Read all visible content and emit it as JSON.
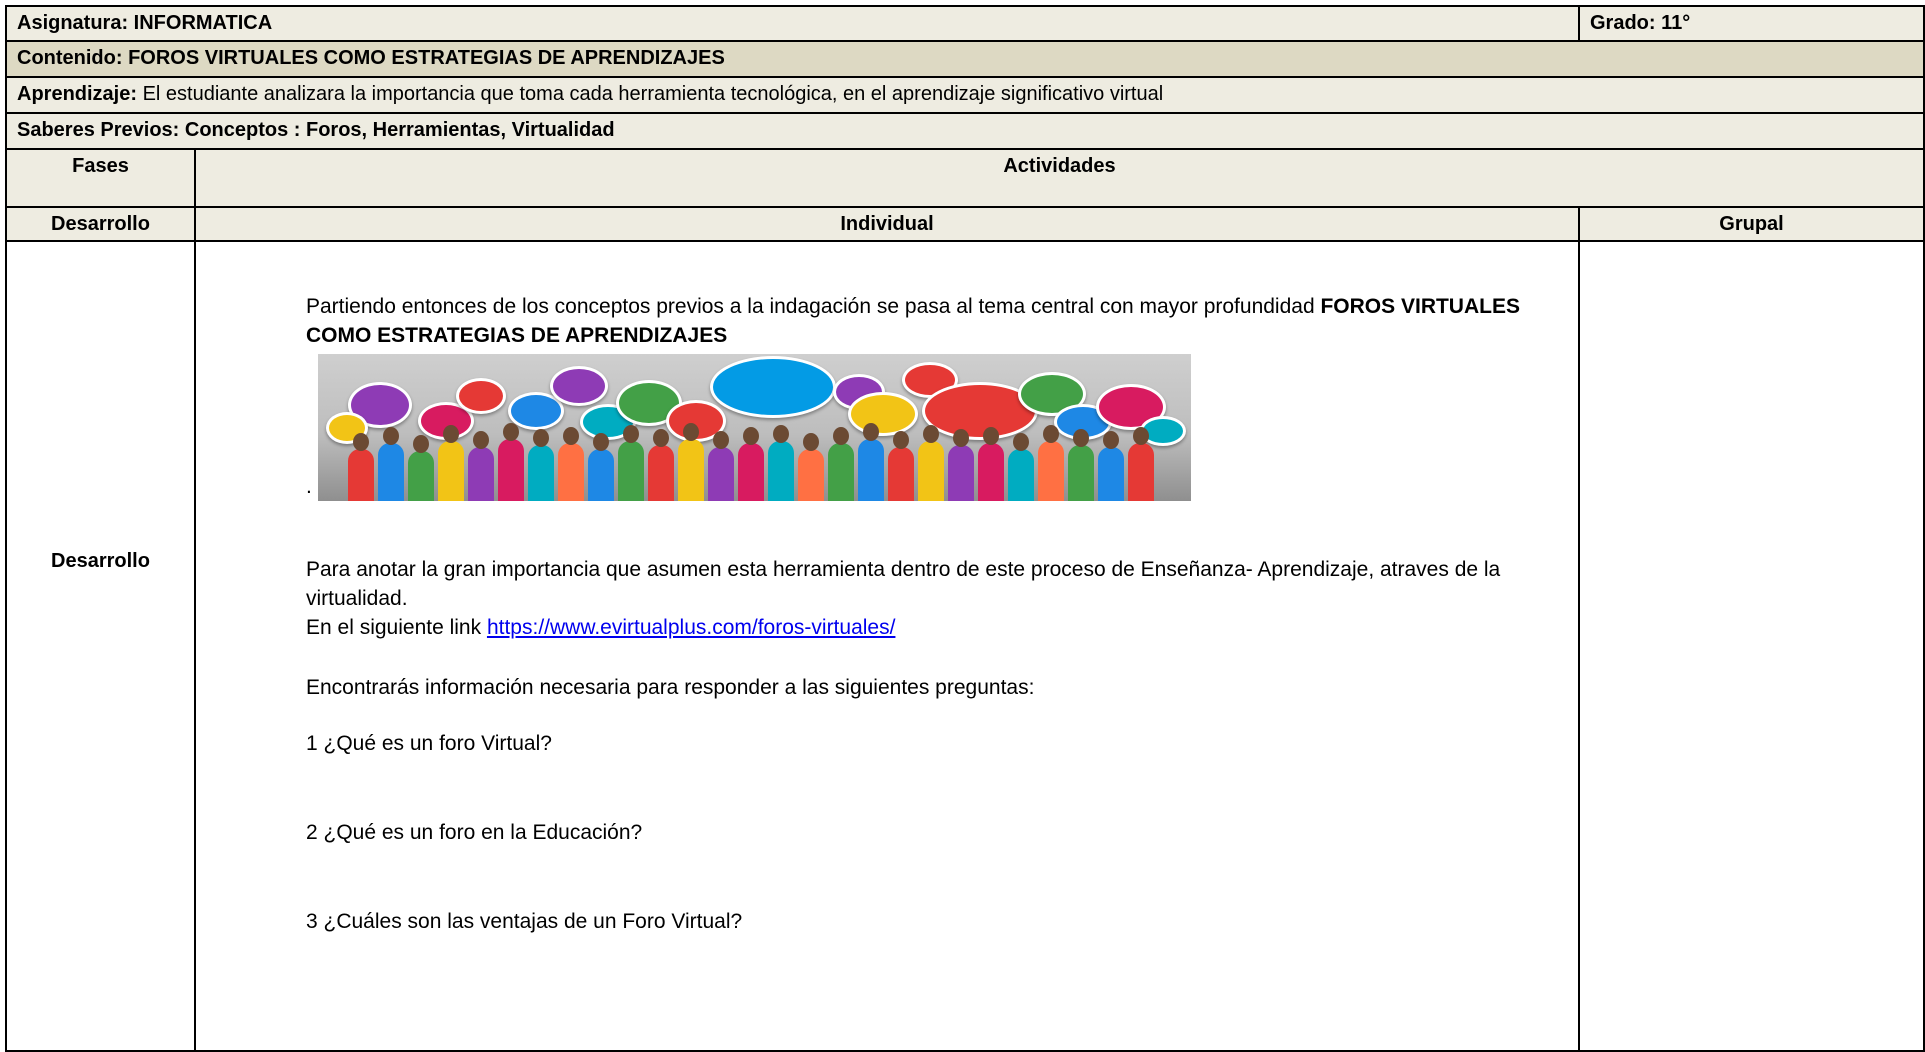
{
  "header": {
    "asignatura": "Asignatura: INFORMATICA",
    "grado": "Grado: 11°",
    "contenido": "Contenido: FOROS VIRTUALES COMO ESTRATEGIAS DE APRENDIZAJES",
    "aprendizaje_label": "Aprendizaje:",
    "aprendizaje_text": " El estudiante analizara la importancia que toma cada herramienta tecnológica, en el aprendizaje significativo virtual",
    "saberes": "Saberes Previos:  Conceptos : Foros,  Herramientas, Virtualidad"
  },
  "columns": {
    "fases": "Fases",
    "actividades": "Actividades",
    "desarrollo": "Desarrollo",
    "individual": "Individual",
    "grupal": "Grupal"
  },
  "row": {
    "fase": "Desarrollo",
    "intro_text": "Partiendo entonces de los conceptos previos a la indagación se pasa al tema central con mayor profundidad ",
    "intro_bold": "FOROS VIRTUALES COMO ESTRATEGIAS DE APRENDIZAJES",
    "image_dot": ".",
    "para1": "Para anotar la gran importancia que asumen esta herramienta dentro de este proceso de Enseñanza- Aprendizaje,  atraves de la virtualidad.",
    "link_prefix": "En el siguiente link ",
    "link_text": "https://www.evirtualplus.com/foros-virtuales/",
    "para2": "Encontrarás  información necesaria para responder a las siguientes preguntas:",
    "q1": "1 ¿Qué es un foro Virtual?",
    "q2": "2 ¿Qué es un foro en la Educación?",
    "q3": "3 ¿Cuáles son las ventajas de un Foro Virtual?"
  },
  "colors": {
    "header_shade": "#eeece1",
    "content_shade": "#ddd9c3",
    "link": "#0000ee"
  }
}
